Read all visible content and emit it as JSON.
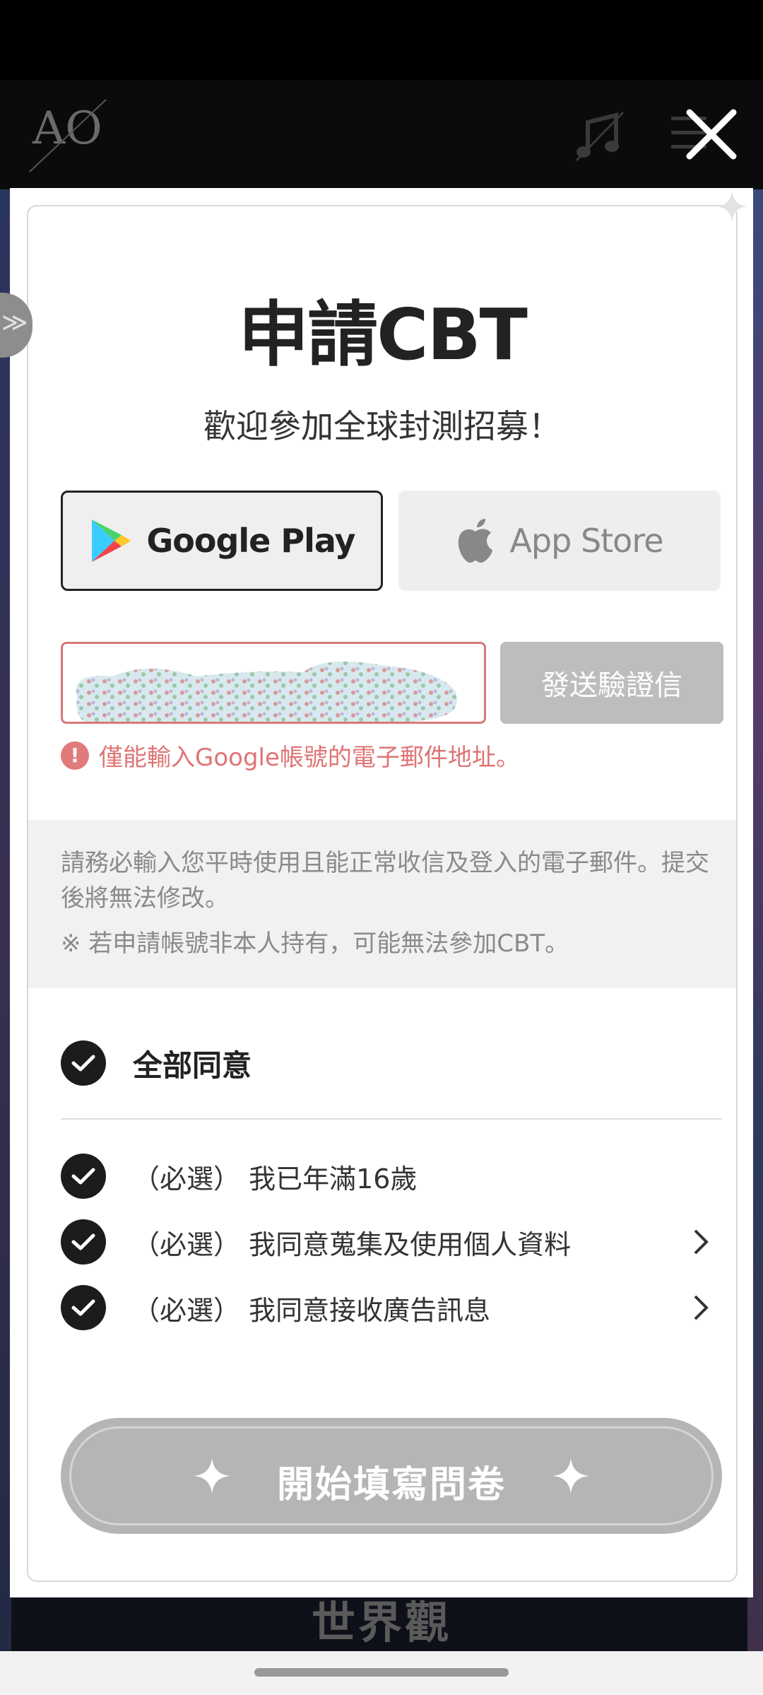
{
  "header": {
    "logo_text": "AO"
  },
  "dialog": {
    "title": "申請CBT",
    "subtitle": "歡迎參加全球封測招募！",
    "stores": [
      {
        "label": "Google Play",
        "selected": true
      },
      {
        "label": "App Store",
        "selected": false
      }
    ],
    "email": {
      "value": "",
      "placeholder": ""
    },
    "send_button": "發送驗證信",
    "error_icon": "!",
    "error_text": "僅能輸入Google帳號的電子郵件地址。",
    "notice_1": "請務必輸入您平時使用且能正常收信及登入的電子郵件。提交後將無法修改。",
    "notice_2": "※ 若申請帳號非本人持有，可能無法參加CBT。",
    "agree_all": "全部同意",
    "terms": [
      {
        "label": "（必選） 我已年滿16歲",
        "checked": true,
        "has_detail": false
      },
      {
        "label": "（必選） 我同意蒐集及使用個人資料",
        "checked": true,
        "has_detail": true
      },
      {
        "label": "（必選） 我同意接收廣告訊息",
        "checked": true,
        "has_detail": true
      }
    ],
    "start_button": "開始填寫問卷"
  },
  "background": {
    "section_title": "世界觀"
  },
  "colors": {
    "error": "#df7475",
    "disabled": "#bdbdbd",
    "check": "#1c1c1c"
  }
}
